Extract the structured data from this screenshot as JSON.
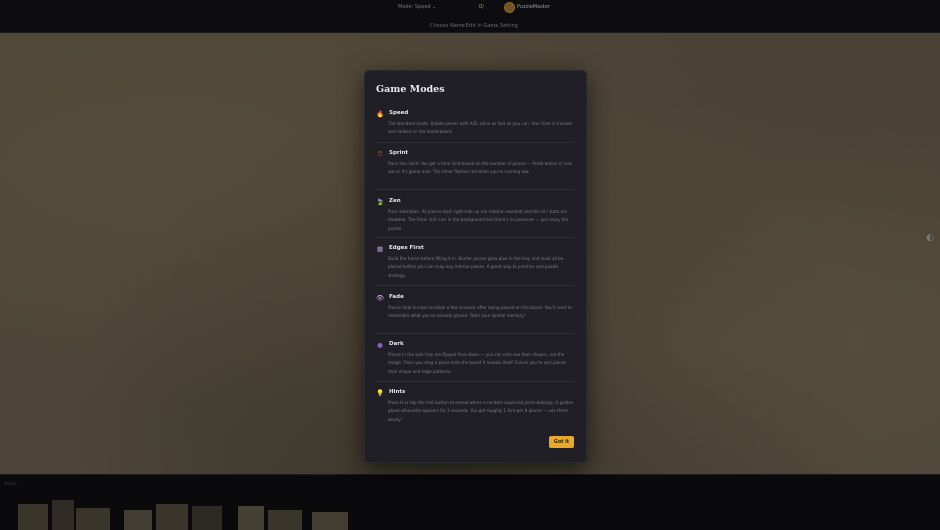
{
  "header": {
    "mode_select": "Mode: Speed",
    "mode_caret": "⌄",
    "separator": "·",
    "count_prefix": "0",
    "count_suffix": "/",
    "brand": "PuzzleMaster",
    "choose_link": "Choose Name",
    "toggle_link": "Edit in Game Setting"
  },
  "tray": {
    "label": "Pieces"
  },
  "modal": {
    "title": "Game Modes",
    "modes": [
      {
        "icon": "🔥",
        "name": "Speed",
        "desc": "The standard mode. Rotate pieces with A/D, solve as fast as you can. Your time is tracked and ranked on the leaderboard."
      },
      {
        "icon": "⏱",
        "name": "Sprint",
        "desc": "Race the clock! You get a time limit based on the number of pieces — finish before it runs out or it's game over. The timer flashes red when you're running low."
      },
      {
        "icon": "🍃",
        "name": "Zen",
        "desc": "Pure relaxation. All pieces start right-side up (no rotation needed) and the AI / stats are disabled. The timer still runs in the background but there's no pressure — just enjoy the puzzle."
      },
      {
        "icon": "▦",
        "name": "Edges First",
        "desc": "Build the frame before filling it in. Border pieces glow blue in the tray and must all be placed before you can snap any interior pieces. A great way to practice real puzzle strategy."
      },
      {
        "icon": "👁",
        "name": "Fade",
        "desc": "Pieces fade to near-invisible a few seconds after being placed on the board. You'll need to remember what you've already placed. Tests your spatial memory!"
      },
      {
        "icon": "●",
        "name": "Dark",
        "desc": "Pieces in the side tray are flipped face-down — you can only see their shapes, not the image. Once you drag a piece onto the board it reveals itself. Forces you to sort pieces from shape and edge patterns."
      },
      {
        "icon": "💡",
        "name": "Hints",
        "desc": "Press H or tap the hint button to reveal where a random unplaced piece belongs. A golden ghost silhouette appears for 3 seconds. You get roughly 1 hint per 8 pieces — use them wisely!"
      }
    ],
    "got_it": "Got it"
  },
  "colors": {
    "accent": "#e7a92b",
    "modal_bg": "#1f1f25",
    "page_bg": "#0b0b0d",
    "table_felt": "#4d4538"
  }
}
